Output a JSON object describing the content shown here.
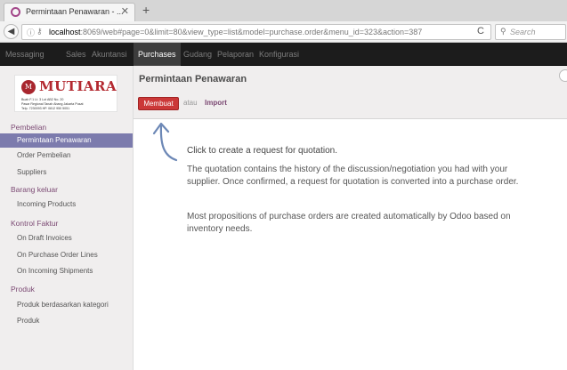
{
  "browser": {
    "tab_title": "Permintaan Penawaran - ...",
    "tab_close": "✕",
    "new_tab": "+",
    "url_host": "localhost",
    "url_rest": ":8069/web#page=0&limit=80&view_type=list&model=purchase.order&menu_id=323&action=387",
    "search_placeholder": "Search"
  },
  "topmenu": {
    "items": [
      "Messaging",
      "Sales",
      "Akuntansi",
      "Purchases",
      "Gudang",
      "Pelaporan",
      "Konfigurasi"
    ],
    "active": "Purchases"
  },
  "logo": {
    "name": "MUTIARA",
    "line1": "Buah F.1 Lt. 3 Lot AB2 No. 20",
    "line2": "Pasar Regional Tanah Abang Jakarta Pusat",
    "line3": "Telp. 7230093 HP. 0812 950 5051"
  },
  "sidebar": {
    "sections": [
      {
        "heading": "Pembelian",
        "items": [
          "Permintaan Penawaran",
          "Order Pembelian",
          "Suppliers"
        ]
      },
      {
        "heading": "Barang keluar",
        "items": [
          "Incoming Products"
        ]
      },
      {
        "heading": "Kontrol Faktur",
        "items": [
          "On Draft Invoices",
          "On Purchase Order Lines",
          "On Incoming Shipments"
        ]
      },
      {
        "heading": "Produk",
        "items": [
          "Produk berdasarkan kategori",
          "Produk"
        ]
      }
    ],
    "active_item": "Permintaan Penawaran"
  },
  "main": {
    "title": "Permintaan Penawaran",
    "create_label": "Membuat",
    "or_label": "atau",
    "import_label": "Import",
    "help_lead": "Click to create a request for quotation.",
    "help_p1": "The quotation contains the history of the discussion/negotiation you had with your supplier. Once confirmed, a request for quotation is converted into a purchase order.",
    "help_p2": "Most propositions of purchase orders are created automatically by Odoo based on inventory needs."
  },
  "colors": {
    "accent": "#7c7bad",
    "create_button": "#cb3838",
    "brand_red": "#b32930",
    "topbar": "#1c1c1c"
  }
}
